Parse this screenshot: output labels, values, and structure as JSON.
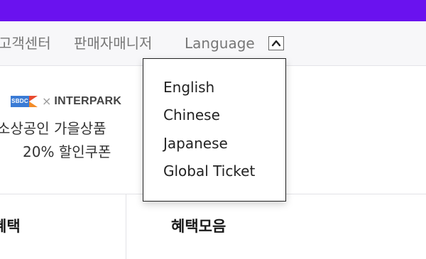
{
  "header": {
    "top_bar_color": "#6a12ef"
  },
  "util_nav": {
    "customer_center": "고객센터",
    "seller_manager": "판매자매니저",
    "language_label": "Language",
    "language_toggle_icon": "chevron-up-icon"
  },
  "language_dropdown": {
    "items": [
      {
        "label": "English"
      },
      {
        "label": "Chinese"
      },
      {
        "label": "Japanese"
      },
      {
        "label": "Global Ticket"
      }
    ]
  },
  "promo": {
    "logo_left_text": "SBDC",
    "logo_separator": "×",
    "logo_right_text": "INTERPARK",
    "line1": "소상공인 가을상품",
    "line2": "20% 할인쿠폰"
  },
  "sections": {
    "left_title": "혜택",
    "right_title": "혜택모음"
  }
}
